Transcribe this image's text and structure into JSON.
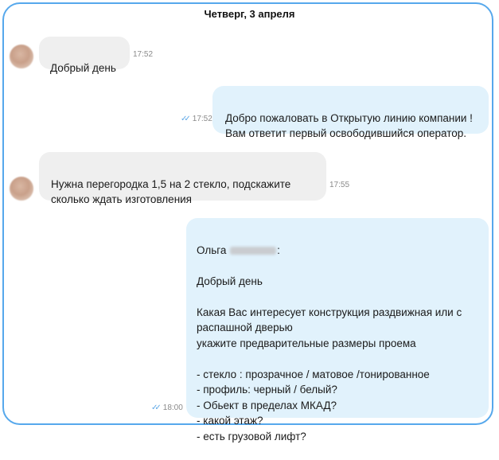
{
  "chat": {
    "date_header": "Четверг, 3 апреля",
    "messages": [
      {
        "direction": "in",
        "text": "Добрый день",
        "time": "17:52"
      },
      {
        "direction": "out",
        "text": "Добро пожаловать в Открытую линию компании !\nВам ответит первый освободившийся оператор.",
        "time": "17:52",
        "read": true
      },
      {
        "direction": "in",
        "text": "Нужна перегородка 1,5 на 2 стекло, подскажите\nсколько ждать изготовления",
        "time": "17:55"
      },
      {
        "direction": "out",
        "sender": "Ольга",
        "sender_suffix": ":",
        "text": "Добрый день\n\nКакая Вас интересует конструкция раздвижная или с\nраспашной дверью\nукажите предварительные размеры проема\n\n- стекло : прозрачное / матовое /тонированное\n- профиль: черный / белый?\n- Обьект в пределах МКАД?\n- какой этаж?\n- есть грузовой лифт?",
        "time": "18:00",
        "read": true
      }
    ]
  },
  "icons": {
    "read_receipt": "double-check-icon",
    "avatar": "user-avatar"
  },
  "colors": {
    "frame": "#56a8ec",
    "incoming_bubble": "#efefef",
    "outgoing_bubble": "#e1f2fc",
    "check": "#5ea8e6"
  }
}
